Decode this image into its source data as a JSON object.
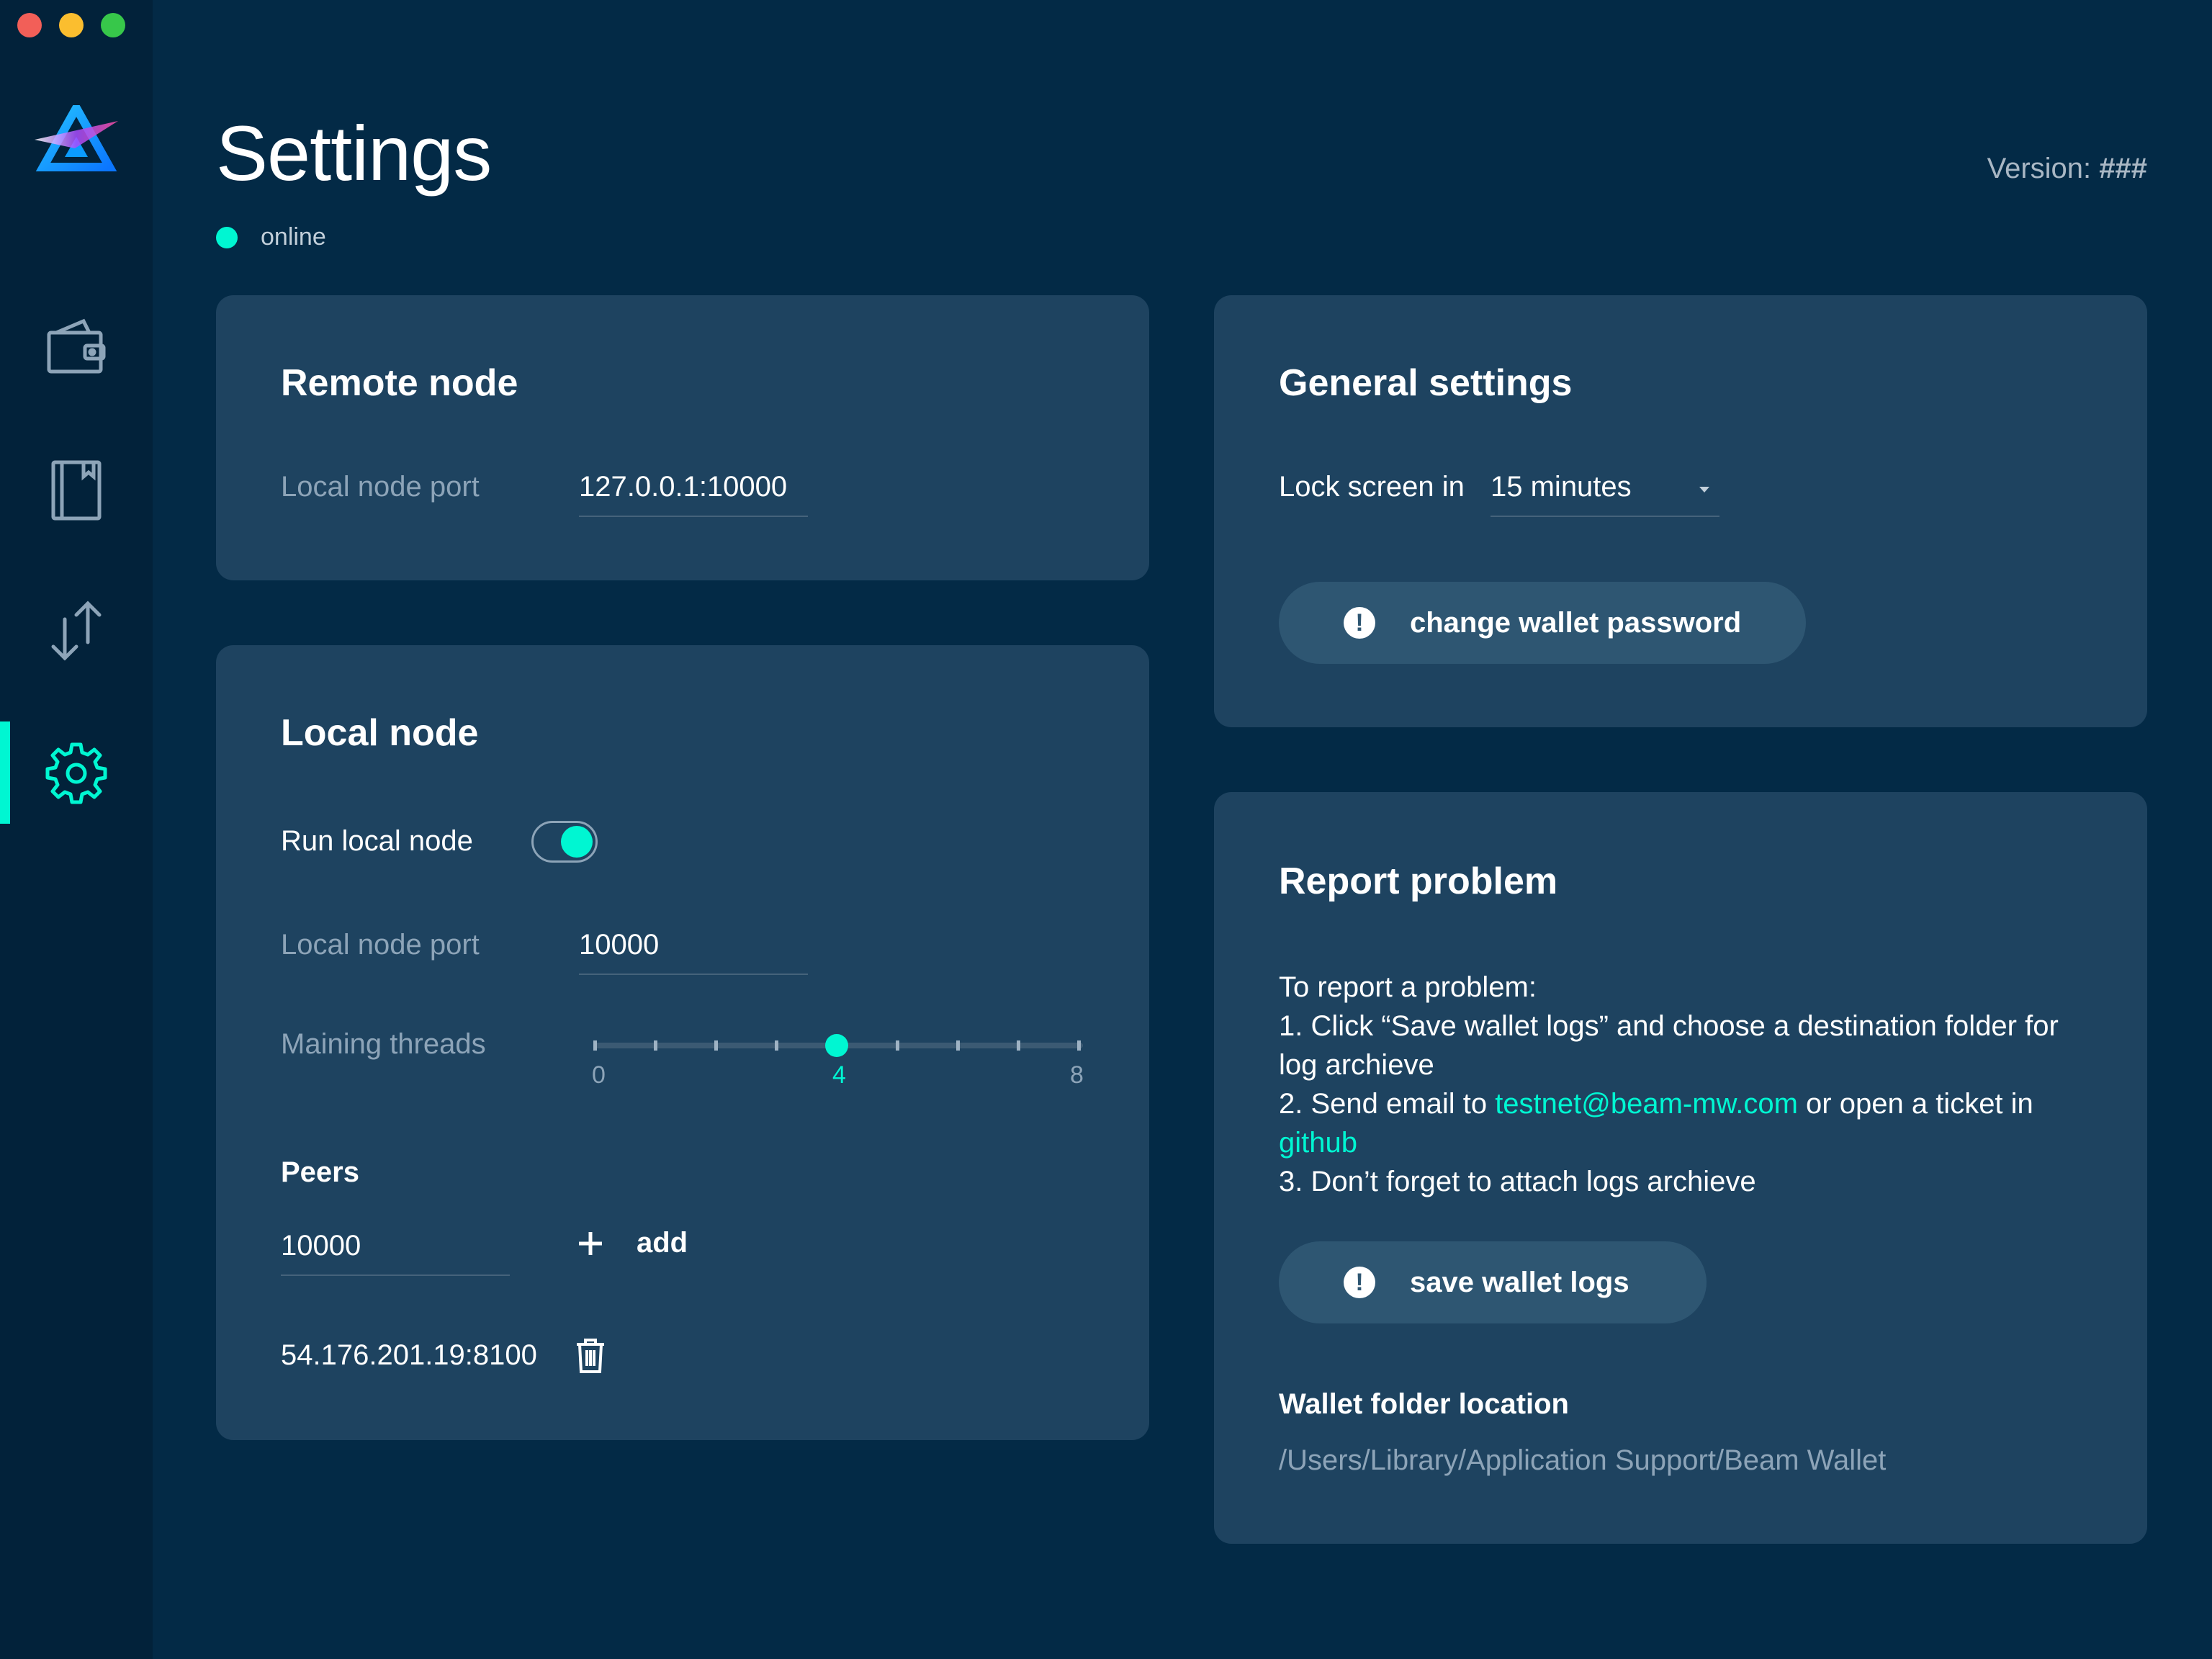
{
  "window": {
    "controls": [
      "close",
      "minimize",
      "zoom"
    ]
  },
  "sidebar": {
    "logo": "beam-logo",
    "items": [
      {
        "icon": "wallet-icon",
        "active": false
      },
      {
        "icon": "address-book-icon",
        "active": false
      },
      {
        "icon": "transactions-icon",
        "active": false
      },
      {
        "icon": "settings-icon",
        "active": true
      }
    ],
    "accent_color": "#00f6d2"
  },
  "header": {
    "title": "Settings",
    "status": "online",
    "version_label": "Version:",
    "version_value": "###"
  },
  "remote_node": {
    "title": "Remote node",
    "port_label": "Local node port",
    "port_value": "127.0.0.1:10000"
  },
  "local_node": {
    "title": "Local node",
    "run_label": "Run local node",
    "run_enabled": true,
    "port_label": "Local node port",
    "port_value": "10000",
    "threads_label": "Maining threads",
    "threads_min": "0",
    "threads_value": "4",
    "threads_max": "8",
    "peers_title": "Peers",
    "peer_input_value": "10000",
    "add_label": "add",
    "peers": [
      "54.176.201.19:8100"
    ]
  },
  "general_settings": {
    "title": "General settings",
    "lock_label": "Lock screen in",
    "lock_value": "15 minutes",
    "change_password_label": "change wallet password"
  },
  "report_problem": {
    "title": "Report problem",
    "intro": "To report a problem:",
    "step1": "1.  Click “Save wallet logs” and choose a destination folder for log archieve",
    "step2_prefix": "2.  Send email to ",
    "step2_email": "testnet@beam-mw.com",
    "step2_middle": " or open a ticket in ",
    "step2_link": "github",
    "step3": "3. Don’t forget to attach logs archieve",
    "save_logs_label": "save wallet logs",
    "folder_title": "Wallet folder location",
    "folder_path": "/Users/Library/Application Support/Beam Wallet"
  }
}
